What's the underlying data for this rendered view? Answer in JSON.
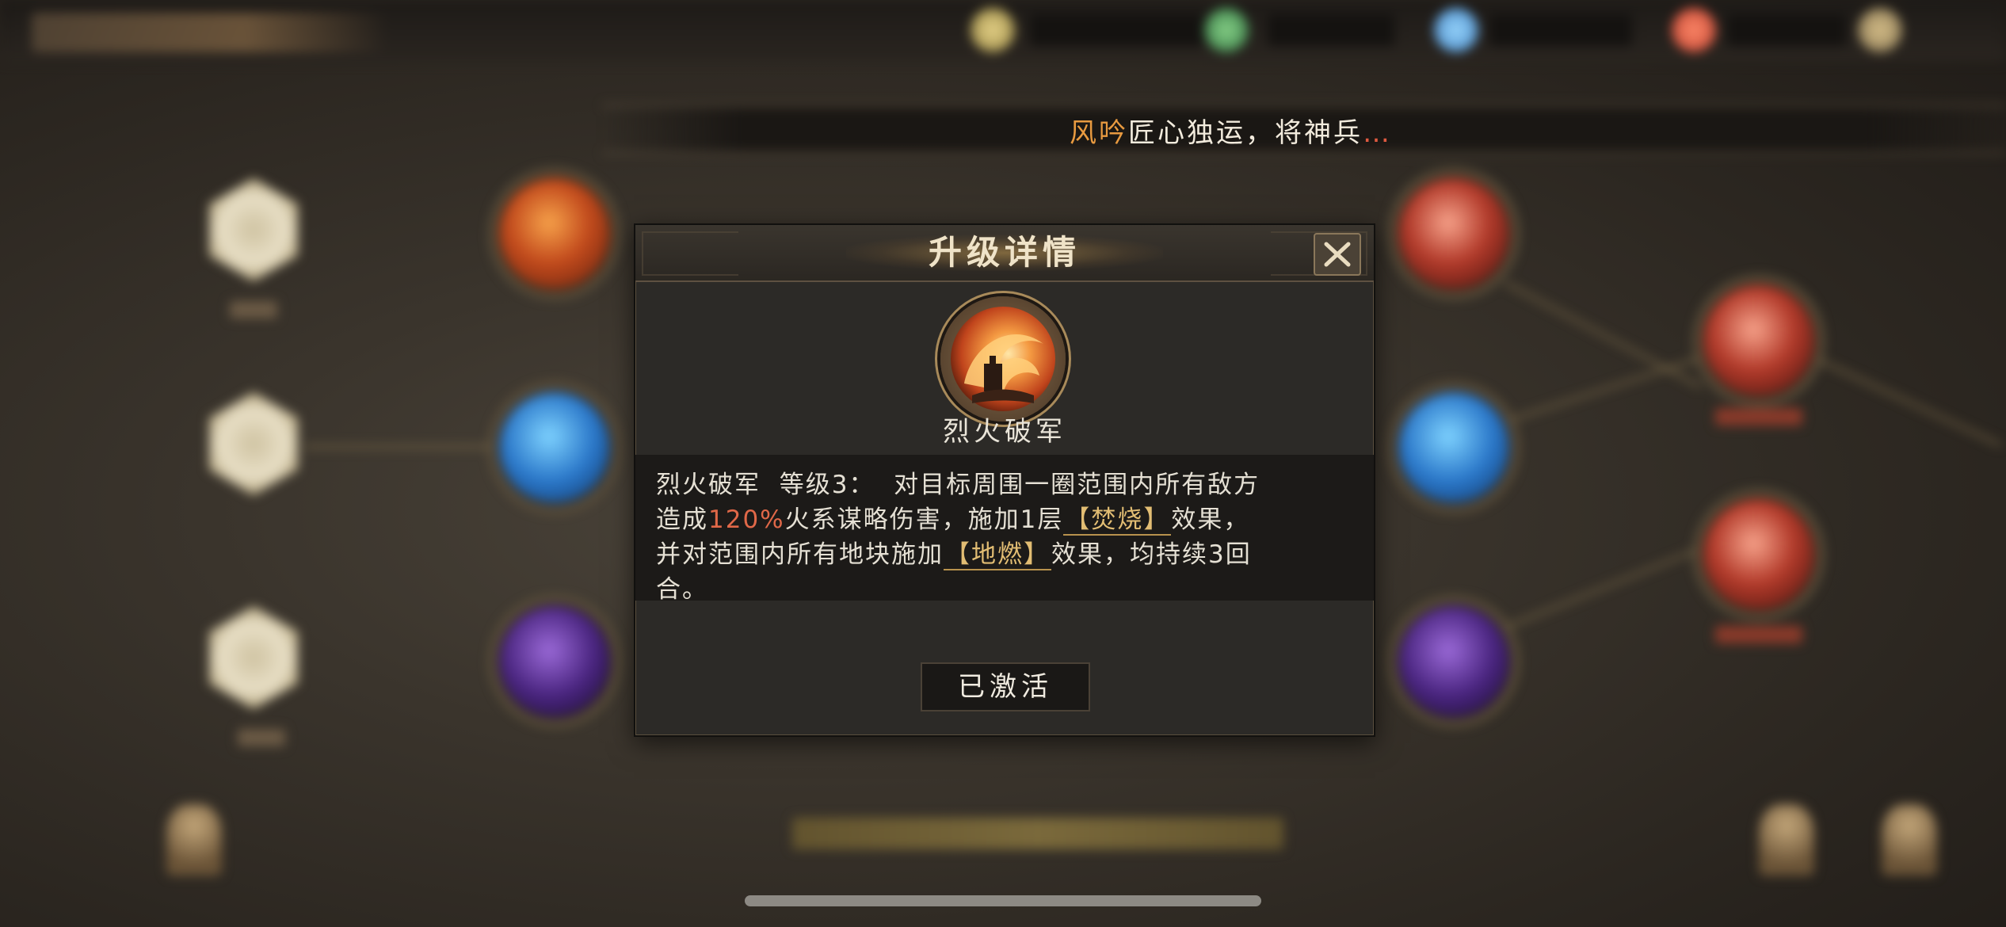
{
  "marquee": {
    "player_name": "风吟",
    "message": "匠心独运，将神兵",
    "tail": "…"
  },
  "dialog": {
    "title": "升级详情",
    "close_icon": "close-x-icon",
    "skill": {
      "icon": "fire-wave-skill-icon",
      "name": "烈火破军"
    },
    "description": {
      "line1": "烈火破军  等级3：  对目标周围一圈范围内所有敌方",
      "line2_pre": "造成",
      "line2_pct": "120%",
      "line2_mid": "火系谋略伤害，施加1层",
      "keyword1": "【焚烧】",
      "line2_post": "效果，",
      "line3_pre": "并对范围内所有地块施加",
      "keyword2": "【地燃】",
      "line3_post": "效果，均持续3回",
      "line4": "合。"
    },
    "status_button": "已激活"
  },
  "colors": {
    "highlight_pct": "#e06848",
    "keyword": "#e2bd73",
    "player_name": "#e89a40",
    "dialog_bg": "#2c2a27"
  }
}
